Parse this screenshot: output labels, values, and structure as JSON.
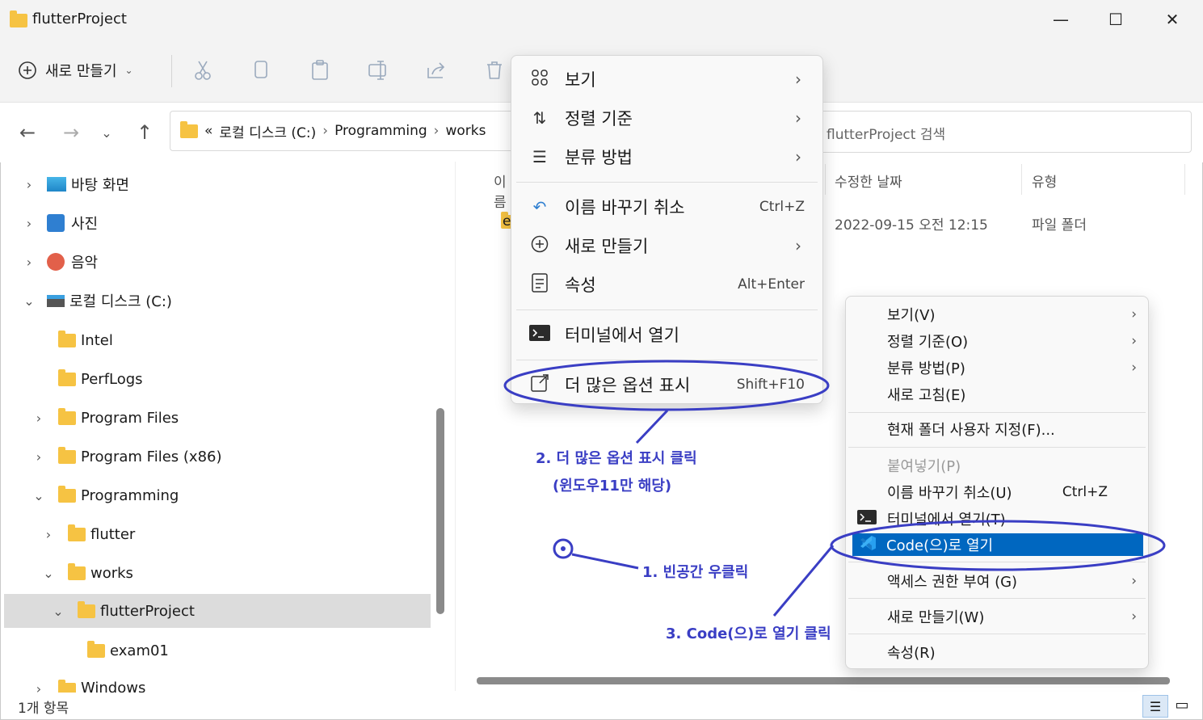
{
  "window": {
    "title": "flutterProject",
    "minimize_glyph": "—",
    "maximize_glyph": "☐",
    "close_glyph": "✕"
  },
  "toolbar": {
    "new_label": "새로 만들기",
    "new_icon": "plus-circle-icon"
  },
  "address": {
    "prefix": "«",
    "crumbs": [
      "로컬 디스크 (C:)",
      "Programming",
      "works"
    ]
  },
  "search": {
    "placeholder": "flutterProject 검색"
  },
  "sidebar": {
    "items": [
      {
        "label": "바탕 화면",
        "chevron": "›"
      },
      {
        "label": "사진",
        "chevron": "›"
      },
      {
        "label": "음악",
        "chevron": "›"
      },
      {
        "label": "로컬 디스크 (C:)",
        "chevron": "⌄"
      },
      {
        "label": "Intel",
        "chevron": ""
      },
      {
        "label": "PerfLogs",
        "chevron": ""
      },
      {
        "label": "Program Files",
        "chevron": "›"
      },
      {
        "label": "Program Files (x86)",
        "chevron": "›"
      },
      {
        "label": "Programming",
        "chevron": "⌄"
      },
      {
        "label": "flutter",
        "chevron": "›"
      },
      {
        "label": "works",
        "chevron": "⌄"
      },
      {
        "label": "flutterProject",
        "chevron": "⌄"
      },
      {
        "label": "exam01",
        "chevron": ""
      },
      {
        "label": "Windows",
        "chevron": "›"
      }
    ]
  },
  "table": {
    "columns": [
      "이름",
      "수정한 날짜",
      "유형"
    ],
    "rows": [
      {
        "name": "exam01",
        "date": "2022-09-15 오전 12:15",
        "type": "파일 폴더"
      }
    ]
  },
  "status": {
    "count": "1개 항목"
  },
  "context_menu_win11": {
    "items": [
      {
        "label": "보기",
        "icon": "grid-icon"
      },
      {
        "label": "정렬 기준",
        "icon": "sort-icon"
      },
      {
        "label": "분류 방법",
        "icon": "list-icon"
      },
      {
        "label": "이름 바꾸기 취소",
        "shortcut": "Ctrl+Z",
        "icon": "undo-icon"
      },
      {
        "label": "새로 만들기",
        "icon": "plus-circle-icon"
      },
      {
        "label": "속성",
        "shortcut": "Alt+Enter",
        "icon": "properties-icon"
      },
      {
        "label": "터미널에서 열기",
        "icon": "terminal-icon"
      },
      {
        "label": "더 많은 옵션 표시",
        "shortcut": "Shift+F10",
        "icon": "more-options-icon"
      }
    ]
  },
  "context_menu_classic": {
    "items": [
      {
        "label": "보기(V)"
      },
      {
        "label": "정렬 기준(O)"
      },
      {
        "label": "분류 방법(P)"
      },
      {
        "label": "새로 고침(E)"
      },
      {
        "label": "현재 폴더 사용자 지정(F)..."
      },
      {
        "label": "붙여넣기(P)"
      },
      {
        "label": "이름 바꾸기 취소(U)",
        "shortcut": "Ctrl+Z"
      },
      {
        "label": "터미널에서 열기(T)"
      },
      {
        "label": "Code(으)로 열기"
      },
      {
        "label": "액세스 권한 부여 (G)"
      },
      {
        "label": "새로 만들기(W)"
      },
      {
        "label": "속성(R)"
      }
    ]
  },
  "annotations": {
    "step1": "1. 빈공간 우클릭",
    "step2_line1": "2. 더 많은 옵션 표시 클릭",
    "step2_line2": "(윈도우11만 해당)",
    "step3": "3. Code(으)로 열기 클릭",
    "color": "#3a3ec4"
  },
  "colors": {
    "accent": "#0067c0",
    "folder": "#f6c343",
    "selection": "#dcdcdc"
  }
}
